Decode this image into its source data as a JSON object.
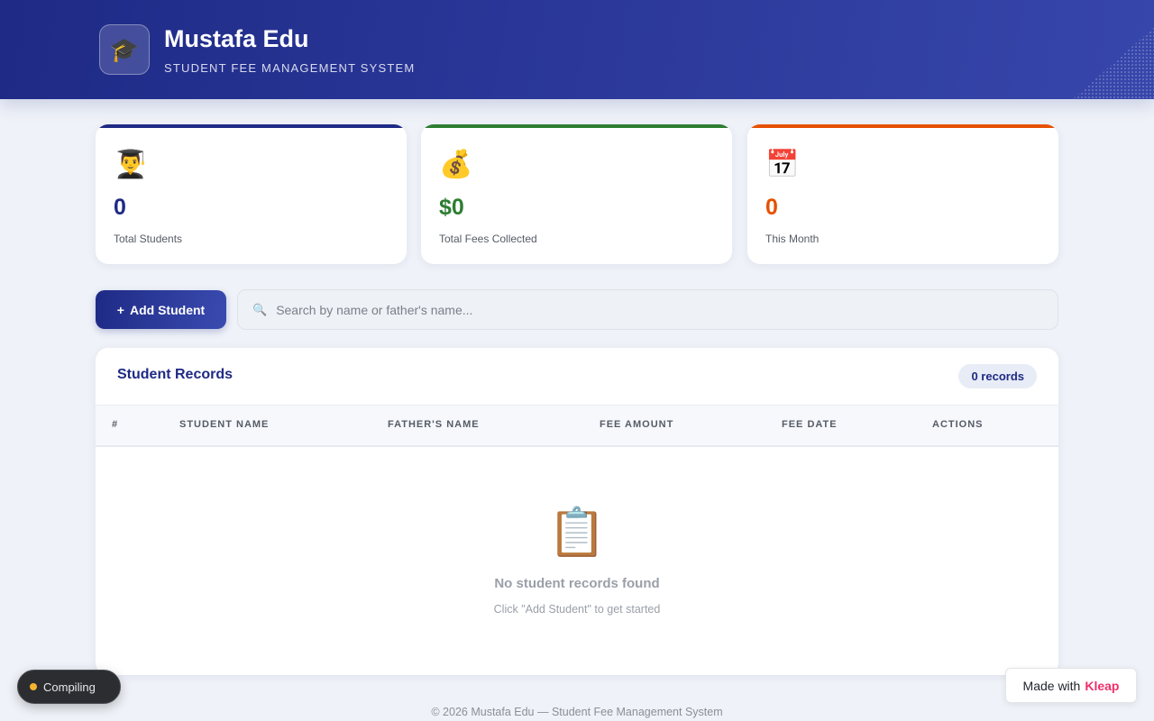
{
  "header": {
    "logo_icon": "🎓",
    "title": "Mustafa Edu",
    "subtitle": "STUDENT FEE MANAGEMENT SYSTEM",
    "colors": {
      "gradient_start": "#1e2a85",
      "gradient_end": "#3746ab"
    }
  },
  "stats": [
    {
      "icon": "👨‍🎓",
      "icon_name": "student-icon",
      "value": "0",
      "label": "Total Students",
      "accent": "#1e2a85"
    },
    {
      "icon": "💰",
      "icon_name": "money-bag-icon",
      "value": "$0",
      "label": "Total Fees Collected",
      "accent": "#2e7d32"
    },
    {
      "icon": "📅",
      "icon_name": "calendar-icon",
      "value": "0",
      "label": "This Month",
      "accent": "#e65100"
    }
  ],
  "toolbar": {
    "add_button_icon": "+",
    "add_button_label": "Add Student",
    "search_icon": "🔍",
    "search_placeholder": "Search by name or father's name...",
    "search_value": ""
  },
  "records": {
    "title": "Student Records",
    "count_badge": "0 records",
    "columns": [
      "#",
      "STUDENT NAME",
      "FATHER'S NAME",
      "FEE AMOUNT",
      "FEE DATE",
      "ACTIONS"
    ],
    "rows": [],
    "empty_icon": "📋",
    "empty_title": "No student records found",
    "empty_subtitle": "Click \"Add Student\" to get started"
  },
  "footer": {
    "text": "© 2026 Mustafa Edu — Student Fee Management System"
  },
  "status": {
    "label": "Compiling",
    "dot_color": "#f5b52e"
  },
  "badge": {
    "prefix": "Made with",
    "brand": "Kleap",
    "brand_color": "#ef2f6b"
  }
}
